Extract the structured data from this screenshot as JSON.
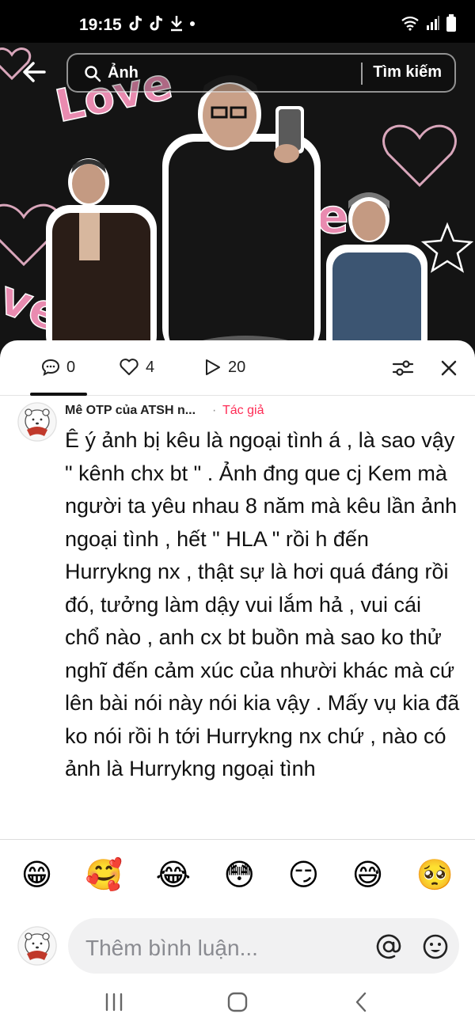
{
  "status_bar": {
    "time": "19:15"
  },
  "search": {
    "query": "Ảnh",
    "button_label": "Tìm kiếm"
  },
  "tabs": {
    "comments_count": "0",
    "likes_count": "4",
    "views_count": "20"
  },
  "comment": {
    "author": "Mê OTP của ATSH n...",
    "separator": "·",
    "badge": "Tác giả",
    "text": "Ê ý ảnh bị kêu là ngoại tình á ,  là sao vậy \" kênh chx bt \" . Ảnh đng que cj Kem mà người ta yêu nhau 8 năm mà kêu lần ảnh ngoại tình , hết \" HLA \" rồi h đến Hurrykng nx , thật sự là hơi quá đáng rồi đó, tưởng làm dậy vui lắm hả , vui cái chổ nào , anh cx bt buồn mà sao ko thử nghĩ đến cảm xúc của nhười khác mà cứ lên bài nói này nói kia vậy . Mấy vụ kia đã ko nói rồi h tới Hurrykng nx chứ , nào có ảnh là Hurrykng ngoại tình"
  },
  "emoji_row": [
    "😁",
    "🥰",
    "😂",
    "😳",
    "😏",
    "😅",
    "🥺"
  ],
  "composer": {
    "placeholder": "Thêm bình luận..."
  },
  "colors": {
    "author_badge": "#fe2c55",
    "input_bg": "#f1f1f2"
  }
}
